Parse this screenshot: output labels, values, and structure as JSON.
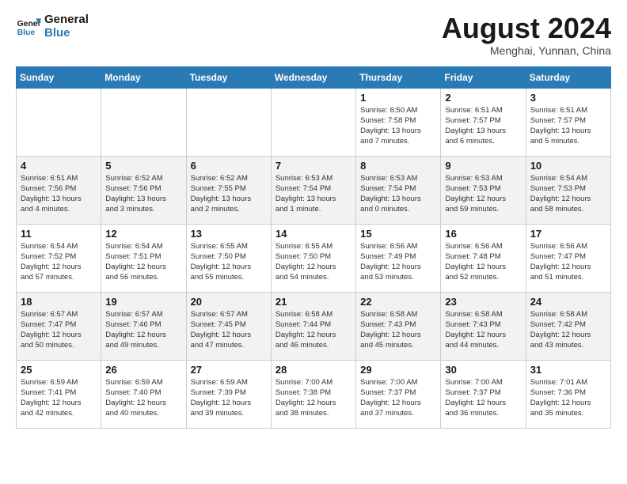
{
  "header": {
    "logo_line1": "General",
    "logo_line2": "Blue",
    "month": "August 2024",
    "location": "Menghai, Yunnan, China"
  },
  "weekdays": [
    "Sunday",
    "Monday",
    "Tuesday",
    "Wednesday",
    "Thursday",
    "Friday",
    "Saturday"
  ],
  "weeks": [
    [
      {
        "day": "",
        "info": ""
      },
      {
        "day": "",
        "info": ""
      },
      {
        "day": "",
        "info": ""
      },
      {
        "day": "",
        "info": ""
      },
      {
        "day": "1",
        "info": "Sunrise: 6:50 AM\nSunset: 7:58 PM\nDaylight: 13 hours\nand 7 minutes."
      },
      {
        "day": "2",
        "info": "Sunrise: 6:51 AM\nSunset: 7:57 PM\nDaylight: 13 hours\nand 6 minutes."
      },
      {
        "day": "3",
        "info": "Sunrise: 6:51 AM\nSunset: 7:57 PM\nDaylight: 13 hours\nand 5 minutes."
      }
    ],
    [
      {
        "day": "4",
        "info": "Sunrise: 6:51 AM\nSunset: 7:56 PM\nDaylight: 13 hours\nand 4 minutes."
      },
      {
        "day": "5",
        "info": "Sunrise: 6:52 AM\nSunset: 7:56 PM\nDaylight: 13 hours\nand 3 minutes."
      },
      {
        "day": "6",
        "info": "Sunrise: 6:52 AM\nSunset: 7:55 PM\nDaylight: 13 hours\nand 2 minutes."
      },
      {
        "day": "7",
        "info": "Sunrise: 6:53 AM\nSunset: 7:54 PM\nDaylight: 13 hours\nand 1 minute."
      },
      {
        "day": "8",
        "info": "Sunrise: 6:53 AM\nSunset: 7:54 PM\nDaylight: 13 hours\nand 0 minutes."
      },
      {
        "day": "9",
        "info": "Sunrise: 6:53 AM\nSunset: 7:53 PM\nDaylight: 12 hours\nand 59 minutes."
      },
      {
        "day": "10",
        "info": "Sunrise: 6:54 AM\nSunset: 7:53 PM\nDaylight: 12 hours\nand 58 minutes."
      }
    ],
    [
      {
        "day": "11",
        "info": "Sunrise: 6:54 AM\nSunset: 7:52 PM\nDaylight: 12 hours\nand 57 minutes."
      },
      {
        "day": "12",
        "info": "Sunrise: 6:54 AM\nSunset: 7:51 PM\nDaylight: 12 hours\nand 56 minutes."
      },
      {
        "day": "13",
        "info": "Sunrise: 6:55 AM\nSunset: 7:50 PM\nDaylight: 12 hours\nand 55 minutes."
      },
      {
        "day": "14",
        "info": "Sunrise: 6:55 AM\nSunset: 7:50 PM\nDaylight: 12 hours\nand 54 minutes."
      },
      {
        "day": "15",
        "info": "Sunrise: 6:56 AM\nSunset: 7:49 PM\nDaylight: 12 hours\nand 53 minutes."
      },
      {
        "day": "16",
        "info": "Sunrise: 6:56 AM\nSunset: 7:48 PM\nDaylight: 12 hours\nand 52 minutes."
      },
      {
        "day": "17",
        "info": "Sunrise: 6:56 AM\nSunset: 7:47 PM\nDaylight: 12 hours\nand 51 minutes."
      }
    ],
    [
      {
        "day": "18",
        "info": "Sunrise: 6:57 AM\nSunset: 7:47 PM\nDaylight: 12 hours\nand 50 minutes."
      },
      {
        "day": "19",
        "info": "Sunrise: 6:57 AM\nSunset: 7:46 PM\nDaylight: 12 hours\nand 49 minutes."
      },
      {
        "day": "20",
        "info": "Sunrise: 6:57 AM\nSunset: 7:45 PM\nDaylight: 12 hours\nand 47 minutes."
      },
      {
        "day": "21",
        "info": "Sunrise: 6:58 AM\nSunset: 7:44 PM\nDaylight: 12 hours\nand 46 minutes."
      },
      {
        "day": "22",
        "info": "Sunrise: 6:58 AM\nSunset: 7:43 PM\nDaylight: 12 hours\nand 45 minutes."
      },
      {
        "day": "23",
        "info": "Sunrise: 6:58 AM\nSunset: 7:43 PM\nDaylight: 12 hours\nand 44 minutes."
      },
      {
        "day": "24",
        "info": "Sunrise: 6:58 AM\nSunset: 7:42 PM\nDaylight: 12 hours\nand 43 minutes."
      }
    ],
    [
      {
        "day": "25",
        "info": "Sunrise: 6:59 AM\nSunset: 7:41 PM\nDaylight: 12 hours\nand 42 minutes."
      },
      {
        "day": "26",
        "info": "Sunrise: 6:59 AM\nSunset: 7:40 PM\nDaylight: 12 hours\nand 40 minutes."
      },
      {
        "day": "27",
        "info": "Sunrise: 6:59 AM\nSunset: 7:39 PM\nDaylight: 12 hours\nand 39 minutes."
      },
      {
        "day": "28",
        "info": "Sunrise: 7:00 AM\nSunset: 7:38 PM\nDaylight: 12 hours\nand 38 minutes."
      },
      {
        "day": "29",
        "info": "Sunrise: 7:00 AM\nSunset: 7:37 PM\nDaylight: 12 hours\nand 37 minutes."
      },
      {
        "day": "30",
        "info": "Sunrise: 7:00 AM\nSunset: 7:37 PM\nDaylight: 12 hours\nand 36 minutes."
      },
      {
        "day": "31",
        "info": "Sunrise: 7:01 AM\nSunset: 7:36 PM\nDaylight: 12 hours\nand 35 minutes."
      }
    ]
  ]
}
